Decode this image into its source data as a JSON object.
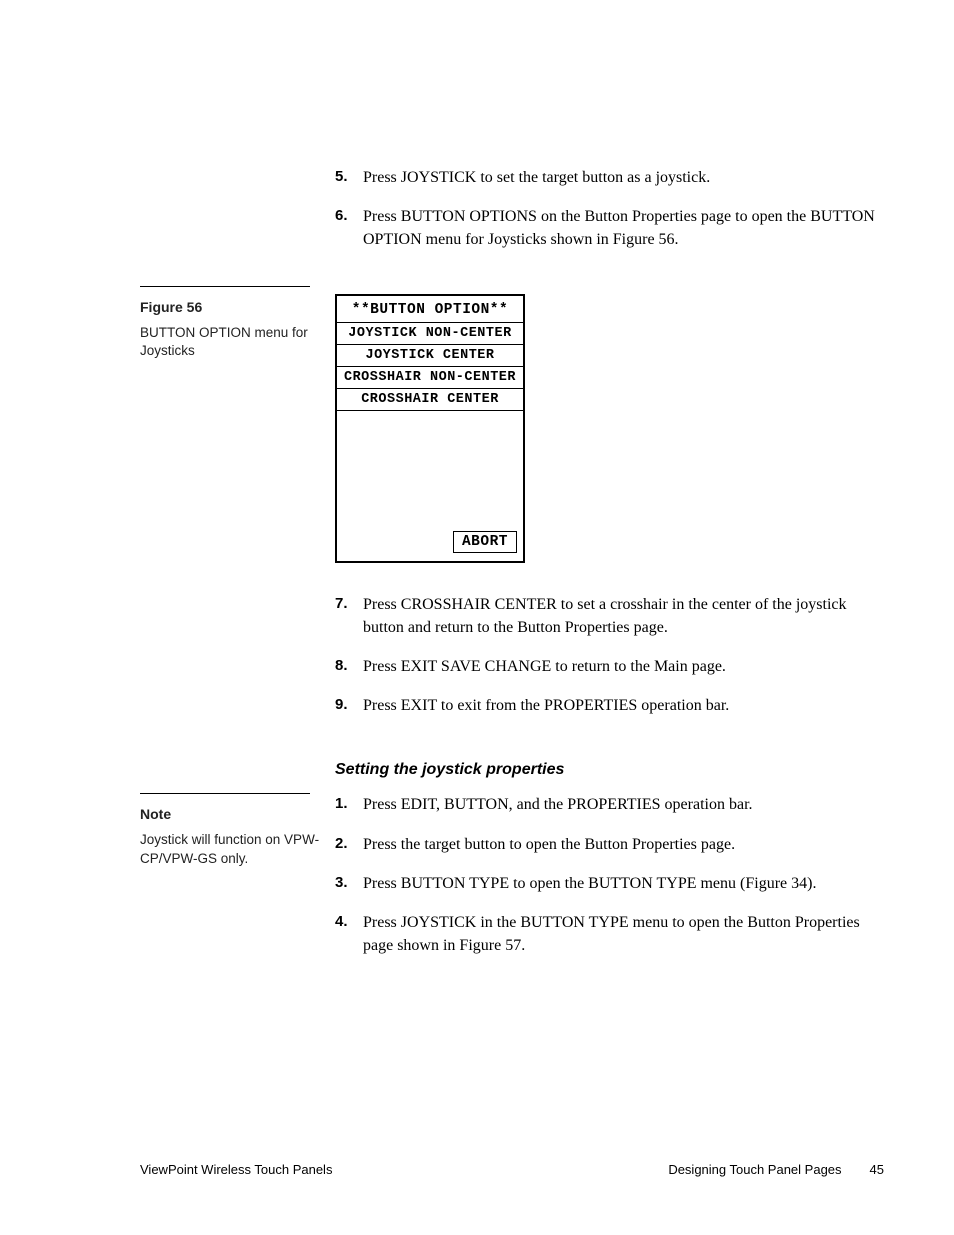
{
  "steps_block1": [
    {
      "n": "5.",
      "t": "Press JOYSTICK to set the target button as a joystick."
    },
    {
      "n": "6.",
      "t": "Press BUTTON OPTIONS on the Button Properties page to open the BUTTON OPTION menu for Joysticks shown in Figure 56."
    }
  ],
  "figure": {
    "label": "Figure 56",
    "caption": "BUTTON OPTION menu for Joysticks",
    "title": "**BUTTON OPTION**",
    "items": [
      "JOYSTICK NON-CENTER",
      "JOYSTICK CENTER",
      "CROSSHAIR NON-CENTER",
      "CROSSHAIR CENTER"
    ],
    "abort": "ABORT"
  },
  "steps_block2": [
    {
      "n": "7.",
      "t": "Press CROSSHAIR CENTER to set a crosshair in the center of the joystick button and return to the Button Properties page."
    },
    {
      "n": "8.",
      "t": "Press EXIT SAVE CHANGE to return to the Main page."
    },
    {
      "n": "9.",
      "t": "Press EXIT to exit from the PROPERTIES operation bar."
    }
  ],
  "section2": {
    "heading": "Setting the joystick properties",
    "note_label": "Note",
    "note_text": "Joystick will function on VPW-CP/VPW-GS only.",
    "steps": [
      {
        "n": "1.",
        "t": "Press EDIT, BUTTON, and the PROPERTIES operation bar."
      },
      {
        "n": "2.",
        "t": "Press the target button to open the Button Properties page."
      },
      {
        "n": "3.",
        "t": "Press BUTTON TYPE to open the BUTTON TYPE menu (Figure 34)."
      },
      {
        "n": "4.",
        "t": "Press JOYSTICK in the BUTTON TYPE menu to open the Button Properties page shown in Figure 57."
      }
    ]
  },
  "footer": {
    "left": "ViewPoint Wireless Touch Panels",
    "right_section": "Designing Touch Panel Pages",
    "page_no": "45"
  }
}
